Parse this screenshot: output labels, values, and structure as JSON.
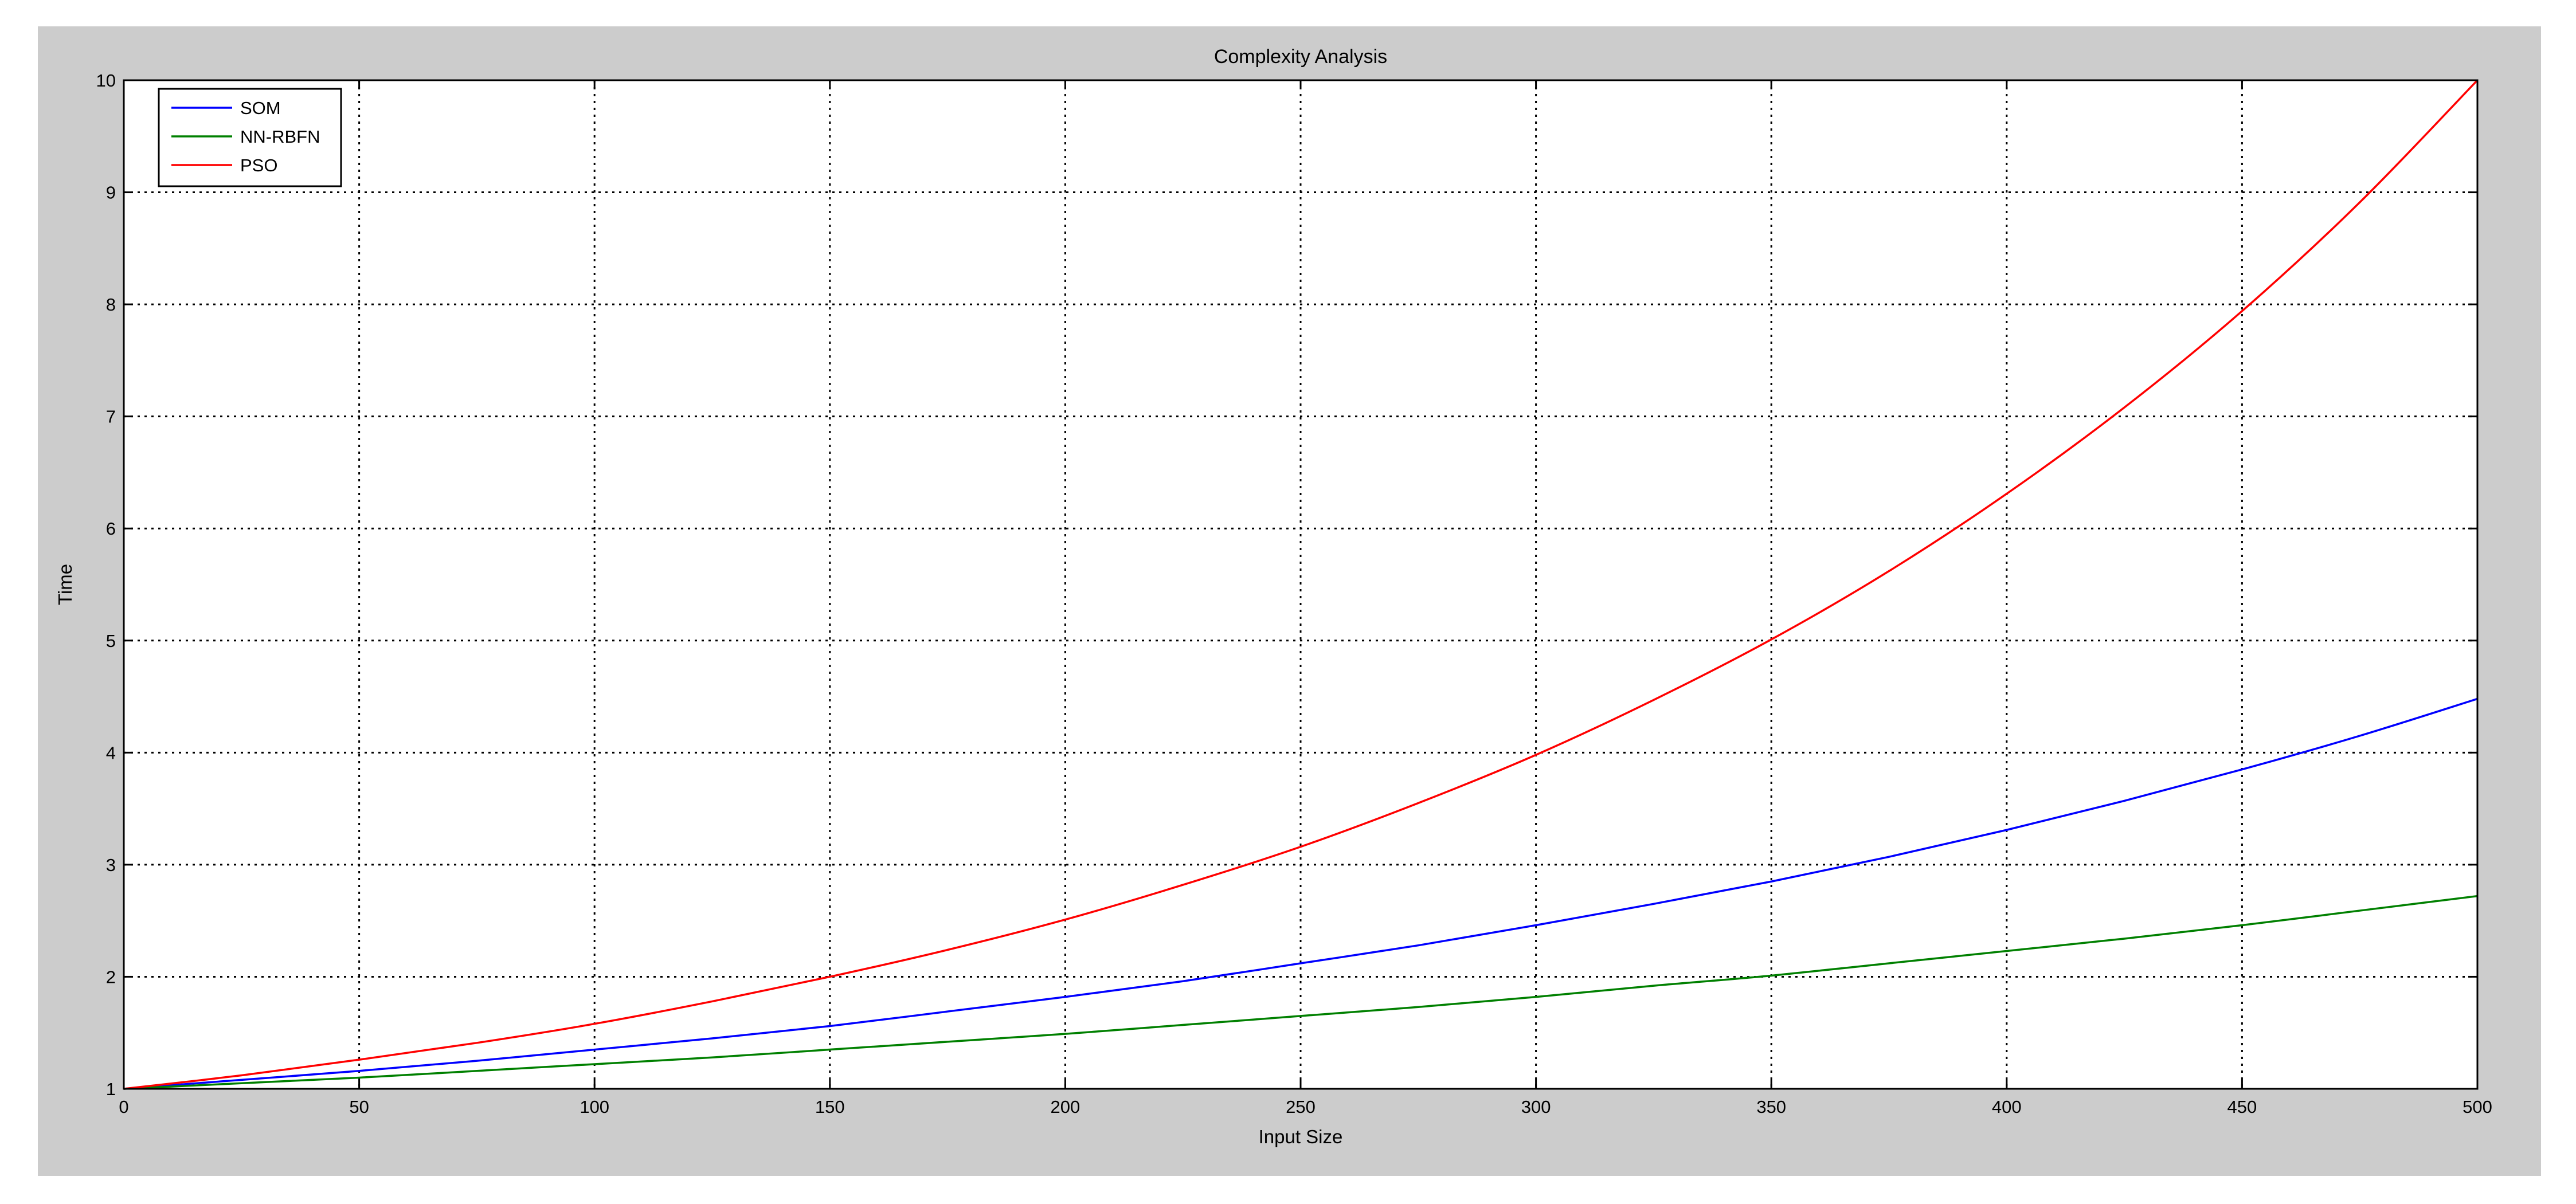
{
  "chart_data": {
    "type": "line",
    "title": "Complexity Analysis",
    "xlabel": "Input Size",
    "ylabel": "Time",
    "xlim": [
      0,
      500
    ],
    "ylim": [
      1,
      10
    ],
    "x_ticks": [
      0,
      50,
      100,
      150,
      200,
      250,
      300,
      350,
      400,
      450,
      500
    ],
    "y_ticks": [
      1,
      2,
      3,
      4,
      5,
      6,
      7,
      8,
      9,
      10
    ],
    "grid": true,
    "grid_style": "dotted",
    "legend_position": "top-left",
    "background_color": "#cccccc",
    "plot_background_color": "#ffffff",
    "x": [
      0,
      25,
      50,
      75,
      100,
      125,
      150,
      175,
      200,
      225,
      250,
      275,
      300,
      325,
      350,
      375,
      400,
      425,
      450,
      475,
      500
    ],
    "series": [
      {
        "name": "SOM",
        "color": "#0000ff",
        "values": [
          1.0,
          1.08,
          1.16,
          1.25,
          1.35,
          1.45,
          1.56,
          1.69,
          1.82,
          1.96,
          2.12,
          2.28,
          2.46,
          2.65,
          2.85,
          3.07,
          3.31,
          3.57,
          3.85,
          4.15,
          4.48
        ]
      },
      {
        "name": "NN-RBFN",
        "color": "#008000",
        "values": [
          1.0,
          1.05,
          1.1,
          1.16,
          1.22,
          1.28,
          1.35,
          1.42,
          1.49,
          1.57,
          1.65,
          1.73,
          1.82,
          1.92,
          2.01,
          2.12,
          2.23,
          2.34,
          2.46,
          2.59,
          2.72
        ]
      },
      {
        "name": "PSO",
        "color": "#ff0000",
        "values": [
          1.0,
          1.12,
          1.26,
          1.41,
          1.58,
          1.78,
          2.0,
          2.24,
          2.51,
          2.82,
          3.16,
          3.55,
          3.98,
          4.47,
          5.01,
          5.62,
          6.31,
          7.08,
          7.94,
          8.91,
          10.0
        ]
      }
    ]
  }
}
